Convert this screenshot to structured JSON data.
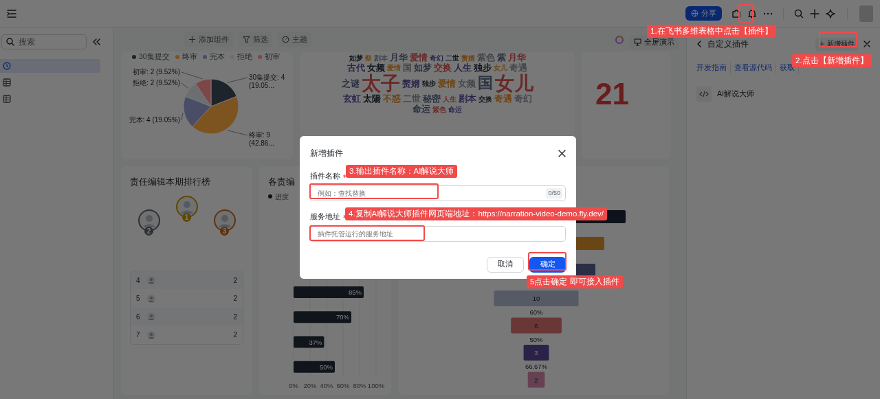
{
  "top_bar": {
    "share_button": "分享"
  },
  "sidebar": {
    "search": {
      "placeholder": "搜索"
    },
    "items": [
      {
        "kind": "dashboard",
        "selected": true
      },
      {
        "kind": "table",
        "selected": false
      },
      {
        "kind": "table",
        "selected": false
      }
    ]
  },
  "toolbar": {
    "buttons": [
      "添加组件",
      "筛选",
      "主题"
    ],
    "present_button": "全屏演示"
  },
  "pie_card": {
    "legend": [
      {
        "color": "#1e242c"
      },
      {
        "color": "#7d5320"
      },
      {
        "color": "#4a4d66"
      },
      {
        "color": "#6b6e73"
      },
      {
        "color": "#7e4747"
      }
    ],
    "chart_data": {
      "type": "pie",
      "categories": [
        "30集提交",
        "终审",
        "完本",
        "拒绝",
        "初审"
      ],
      "values": [
        4,
        9,
        4,
        2,
        2
      ],
      "value_labels": [
        "30集提交: 4 (19.05...",
        "终审: 9 (42.86...",
        "完本: 4 (19.05%)",
        "拒绝: 2 (9.52%)",
        "初审: 2 (9.52%)"
      ]
    }
  },
  "wordcloud_card": {
    "words": [
      {
        "text": "如梦",
        "kind": "small"
      },
      {
        "text": "祭",
        "kind": "small"
      },
      {
        "text": "剧本",
        "kind": "small"
      },
      {
        "text": "月华",
        "kind": "medium"
      },
      {
        "text": "爱情",
        "kind": "medium"
      },
      {
        "text": "奇幻",
        "kind": "small"
      },
      {
        "text": "二世",
        "kind": "small"
      },
      {
        "text": "赘婿",
        "kind": "small"
      },
      {
        "text": "紫色",
        "kind": "medium"
      },
      {
        "text": "紫",
        "kind": "medium"
      },
      {
        "text": "月华",
        "kind": "medium"
      },
      {
        "text": "古代",
        "kind": "medium"
      },
      {
        "text": "女频",
        "kind": "medium"
      },
      {
        "text": "爱情",
        "kind": "small"
      },
      {
        "text": "国",
        "kind": "medium"
      },
      {
        "text": "如梦",
        "kind": "medium"
      },
      {
        "text": "交换",
        "kind": "medium"
      },
      {
        "text": "人生",
        "kind": "medium"
      },
      {
        "text": "独步",
        "kind": "medium"
      },
      {
        "text": "女儿",
        "kind": "small"
      },
      {
        "text": "奇遇",
        "kind": "medium"
      },
      {
        "text": "之谜",
        "kind": "medium"
      },
      {
        "text": "太子",
        "kind": "huge"
      },
      {
        "text": "赘婿",
        "kind": "medium"
      },
      {
        "text": "独步",
        "kind": "small"
      },
      {
        "text": "爱情",
        "kind": "medium"
      },
      {
        "text": "女频",
        "kind": "medium"
      },
      {
        "text": "国",
        "kind": "large"
      },
      {
        "text": "女儿",
        "kind": "huge"
      },
      {
        "text": "玄虹",
        "kind": "medium"
      },
      {
        "text": "太陽",
        "kind": "medium"
      },
      {
        "text": "不惑",
        "kind": "medium"
      },
      {
        "text": "二世",
        "kind": "medium"
      },
      {
        "text": "秘密",
        "kind": "medium"
      },
      {
        "text": "人生",
        "kind": "small"
      },
      {
        "text": "剧本",
        "kind": "medium"
      },
      {
        "text": "交换",
        "kind": "small"
      },
      {
        "text": "奇遇",
        "kind": "medium"
      },
      {
        "text": "奇幻",
        "kind": "medium"
      },
      {
        "text": "命运",
        "kind": "medium"
      },
      {
        "text": "紫色",
        "kind": "small"
      },
      {
        "text": "命运",
        "kind": "small"
      }
    ]
  },
  "number_card": {
    "value": "21"
  },
  "ranking_card": {
    "title": "责任编辑本期排行榜",
    "podium": [
      {
        "rank": "2",
        "kind": "silver"
      },
      {
        "rank": "1",
        "kind": "gold"
      },
      {
        "rank": "3",
        "kind": "bronze"
      }
    ],
    "rows": [
      {
        "rank": "4",
        "value": "2"
      },
      {
        "rank": "5",
        "value": "2"
      },
      {
        "rank": "6",
        "value": "2"
      },
      {
        "rank": "7",
        "value": "2"
      }
    ]
  },
  "progress_card": {
    "title": "各责编",
    "legend": "进度",
    "chart_data": {
      "type": "bar",
      "orientation": "horizontal",
      "categories": [
        null,
        null,
        null,
        null
      ],
      "values": [
        85,
        70,
        37,
        50
      ],
      "value_labels": [
        "85%",
        "70%",
        "37%",
        "50%"
      ],
      "xlim": [
        0,
        100
      ],
      "xticks": [
        {
          "value": 0,
          "label": "0%"
        },
        {
          "value": 20,
          "label": "20%"
        },
        {
          "value": 40,
          "label": "40%"
        },
        {
          "value": 60,
          "label": "60%"
        },
        {
          "value": 80,
          "label": "80%"
        },
        {
          "value": 100,
          "label": "100%"
        }
      ]
    }
  },
  "funnel_card": {
    "stages": [
      {
        "value": "10",
        "rate": "60%"
      },
      {
        "value": "6",
        "rate": "50%"
      },
      {
        "value": "3",
        "rate": "66.67%"
      },
      {
        "value": "2"
      }
    ]
  },
  "plugin_panel": {
    "title": "自定义插件",
    "add_button": "新增插件",
    "links": [
      "开发指南",
      "查看源代码",
      "获取"
    ],
    "plugins": [
      {
        "name": "AI解说大师"
      }
    ]
  },
  "dialog": {
    "title": "新增插件",
    "fields": [
      {
        "label": "插件名称",
        "required": true,
        "placeholder": "例如：查找替换",
        "counter": "0/50"
      },
      {
        "label": "服务地址",
        "required": true,
        "placeholder": "插件托管运行的服务地址"
      }
    ],
    "cancel": "取消",
    "confirm": "确定"
  },
  "annotations": [
    {
      "text": "1.在飞书多维表格中点击【插件】"
    },
    {
      "text": "2.点击【新增插件】"
    },
    {
      "text": "3.输出插件名称：AI解说大师"
    },
    {
      "text": "4.复制AI解说大师插件网页端地址：https://narration-video-demo.fly.dev/"
    },
    {
      "text": "5点击确定 即可接入插件"
    }
  ]
}
